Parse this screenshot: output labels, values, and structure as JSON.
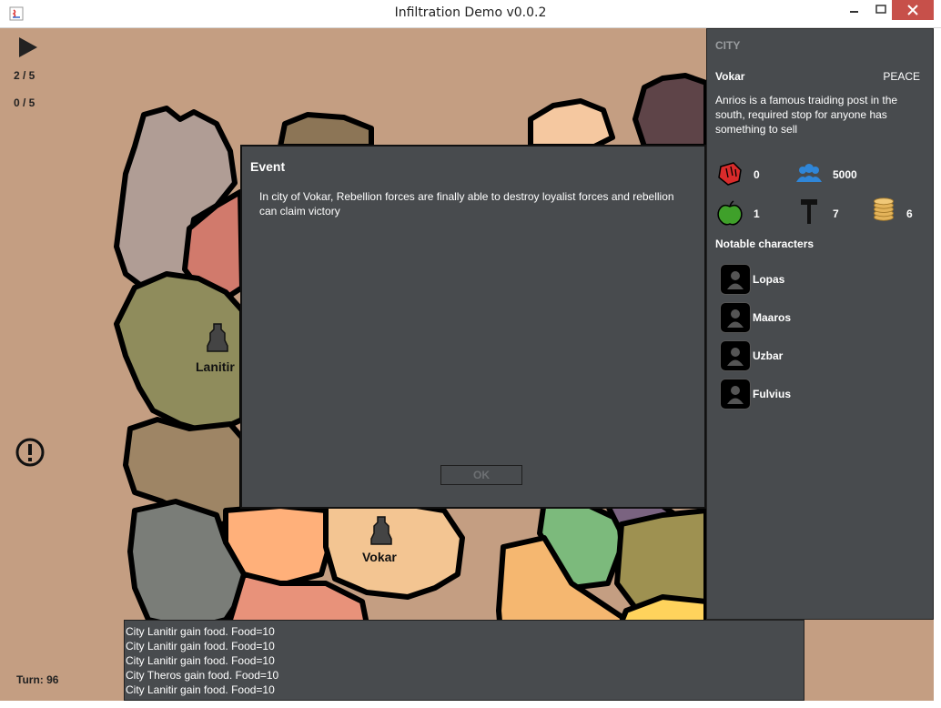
{
  "window": {
    "title": "Infiltration Demo v0.0.2"
  },
  "toolbar": {
    "counter_agents": "2 / 5",
    "counter_ops": "0 / 5",
    "turn_label": "Turn: 96"
  },
  "map": {
    "cities": [
      {
        "name": "Lanitir"
      },
      {
        "name": "Vokar"
      }
    ]
  },
  "city_panel": {
    "header": "CITY",
    "name": "Vokar",
    "state": "PEACE",
    "description": "Anrios is a famous traiding post in the south, required stop for anyone has something to sell",
    "stats": {
      "unrest": "0",
      "population": "5000",
      "food": "1",
      "production": "7",
      "gold": "6"
    },
    "characters_title": "Notable characters",
    "characters": [
      "Lopas",
      "Maaros",
      "Uzbar",
      "Fulvius"
    ]
  },
  "log": [
    "City Lanitir gain food. Food=10",
    "City Lanitir gain food. Food=10",
    "City Lanitir gain food. Food=10",
    "City Theros gain food. Food=10",
    "City Lanitir gain food. Food=10"
  ],
  "dialog": {
    "title": "Event",
    "message": "In city of Vokar, Rebellion forces are finally able to destroy loyalist forces and rebellion can claim victory",
    "ok_label": "OK"
  },
  "colors": {
    "background": "#c49e82",
    "panel": "#484b4e",
    "close_button": "#c7504a",
    "population_icon": "#2f86d8",
    "unrest_icon": "#d92b2b",
    "food_icon": "#3fa02a",
    "gold_icon": "#e3b35a"
  }
}
